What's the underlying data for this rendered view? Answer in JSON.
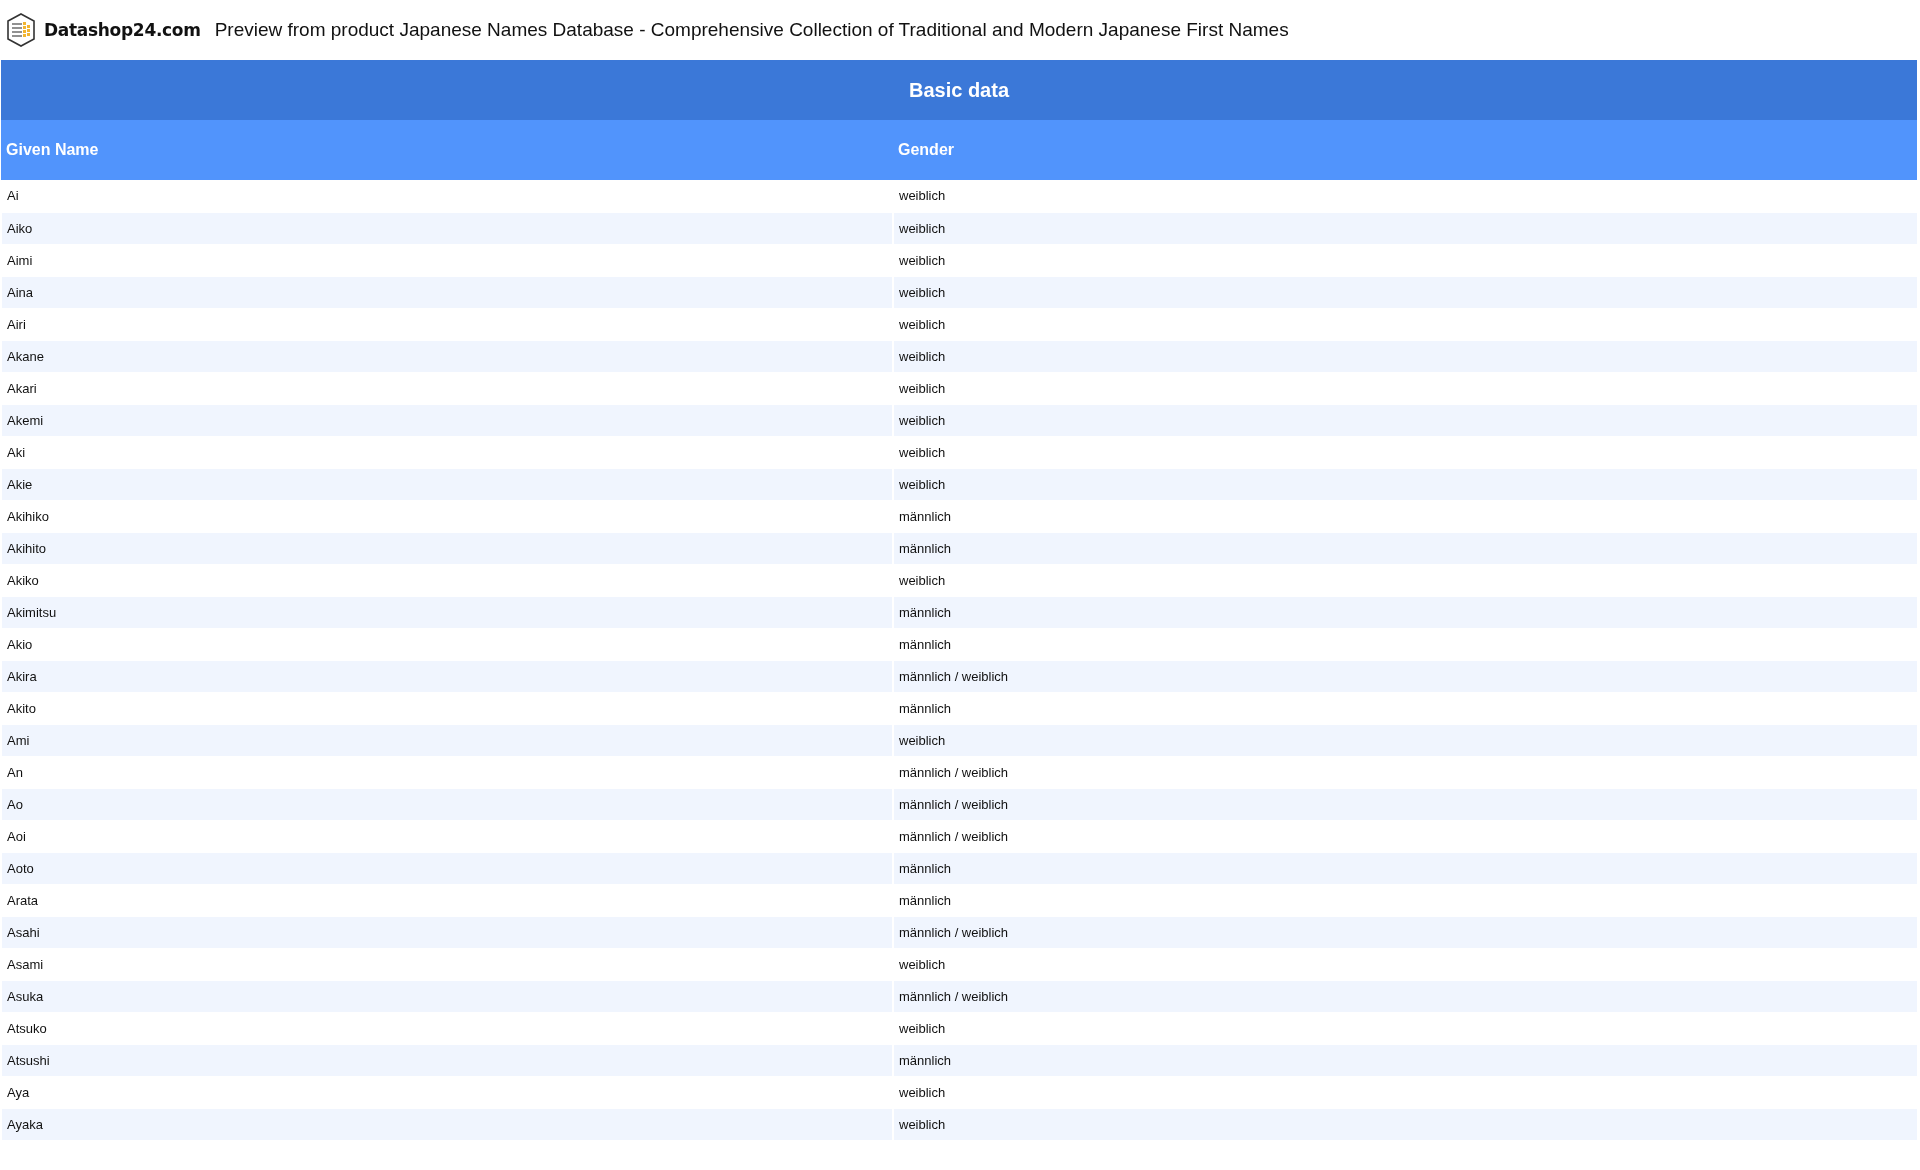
{
  "header": {
    "brand": "Datashop24.com",
    "title": "Preview from product Japanese Names Database - Comprehensive Collection of Traditional and Modern Japanese First Names"
  },
  "table": {
    "caption": "Basic data",
    "columns": [
      "Given Name",
      "Gender"
    ],
    "rows": [
      [
        "Ai",
        "weiblich"
      ],
      [
        "Aiko",
        "weiblich"
      ],
      [
        "Aimi",
        "weiblich"
      ],
      [
        "Aina",
        "weiblich"
      ],
      [
        "Airi",
        "weiblich"
      ],
      [
        "Akane",
        "weiblich"
      ],
      [
        "Akari",
        "weiblich"
      ],
      [
        "Akemi",
        "weiblich"
      ],
      [
        "Aki",
        "weiblich"
      ],
      [
        "Akie",
        "weiblich"
      ],
      [
        "Akihiko",
        "männlich"
      ],
      [
        "Akihito",
        "männlich"
      ],
      [
        "Akiko",
        "weiblich"
      ],
      [
        "Akimitsu",
        "männlich"
      ],
      [
        "Akio",
        "männlich"
      ],
      [
        "Akira",
        "männlich / weiblich"
      ],
      [
        "Akito",
        "männlich"
      ],
      [
        "Ami",
        "weiblich"
      ],
      [
        "An",
        "männlich / weiblich"
      ],
      [
        "Ao",
        "männlich / weiblich"
      ],
      [
        "Aoi",
        "männlich / weiblich"
      ],
      [
        "Aoto",
        "männlich"
      ],
      [
        "Arata",
        "männlich"
      ],
      [
        "Asahi",
        "männlich / weiblich"
      ],
      [
        "Asami",
        "weiblich"
      ],
      [
        "Asuka",
        "männlich / weiblich"
      ],
      [
        "Atsuko",
        "weiblich"
      ],
      [
        "Atsushi",
        "männlich"
      ],
      [
        "Aya",
        "weiblich"
      ],
      [
        "Ayaka",
        "weiblich"
      ]
    ]
  }
}
